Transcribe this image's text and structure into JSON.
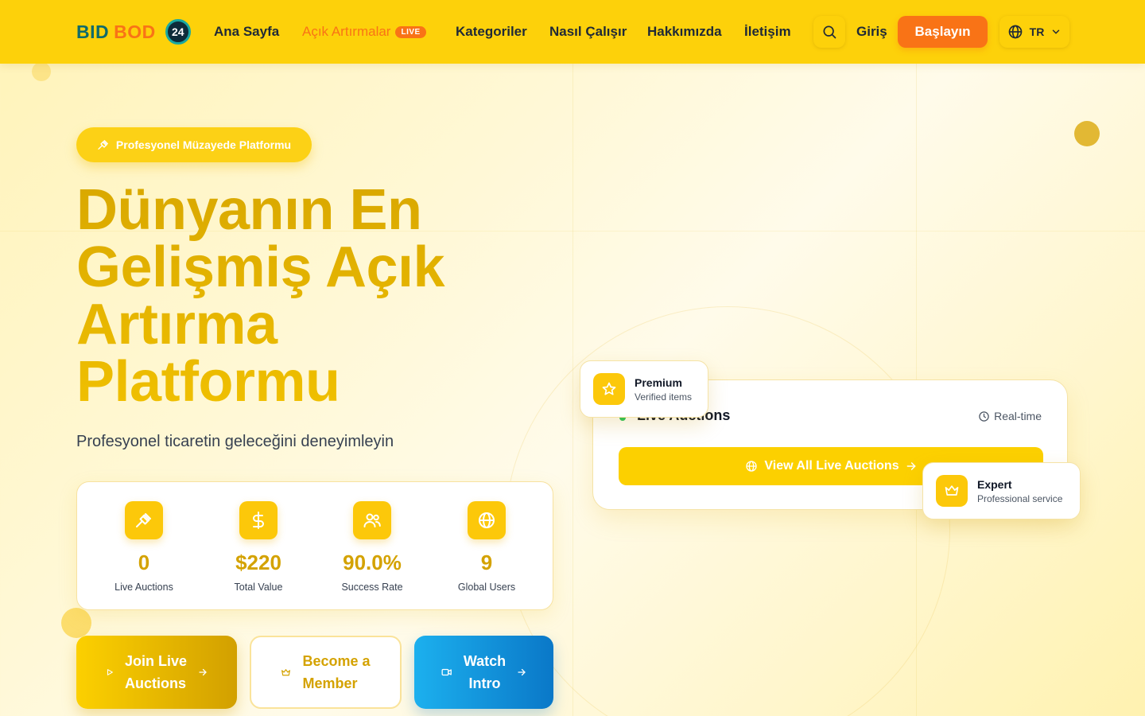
{
  "brand": {
    "bid": "BID",
    "bod": "BOD",
    "badge": "24"
  },
  "nav": {
    "home": "Ana Sayfa",
    "auctions": "Açık Artırmalar",
    "live_badge": "LIVE",
    "categories": "Kategoriler",
    "how_it_works": "Nasıl Çalışır",
    "about": "Hakkımızda",
    "contact": "İletişim",
    "login": "Giriş",
    "cta": "Başlayın",
    "lang": "TR"
  },
  "hero": {
    "pill": "Profesyonel Müzayede Platformu",
    "title_lines": [
      "Dünyanın En",
      "Gelişmiş Açık",
      "Artırma",
      "Platformu"
    ],
    "subtitle": "Profesyonel ticaretin geleceğini deneyimleyin"
  },
  "stats": [
    {
      "value": "0",
      "label": "Live Auctions",
      "icon": "gavel-icon"
    },
    {
      "value": "$220",
      "label": "Total Value",
      "icon": "dollar-icon"
    },
    {
      "value": "90.0%",
      "label": "Success Rate",
      "icon": "users-icon"
    },
    {
      "value": "9",
      "label": "Global Users",
      "icon": "globe-icon"
    }
  ],
  "actions": {
    "join": [
      "Join Live",
      "Auctions"
    ],
    "member": [
      "Become a",
      "Member"
    ],
    "watch": [
      "Watch",
      "Intro"
    ]
  },
  "live_panel": {
    "title": "Live Auctions",
    "realtime": "Real-time",
    "view_all": "View All Live Auctions"
  },
  "badges": {
    "premium": {
      "title": "Premium",
      "sub": "Verified items"
    },
    "expert": {
      "title": "Expert",
      "sub": "Professional service"
    }
  },
  "colors": {
    "nav_bg": "#fdd10a",
    "accent_orange": "#f97316",
    "gold": "#d4a200",
    "blue": "#0a78c8",
    "live_green": "#22c55e"
  }
}
